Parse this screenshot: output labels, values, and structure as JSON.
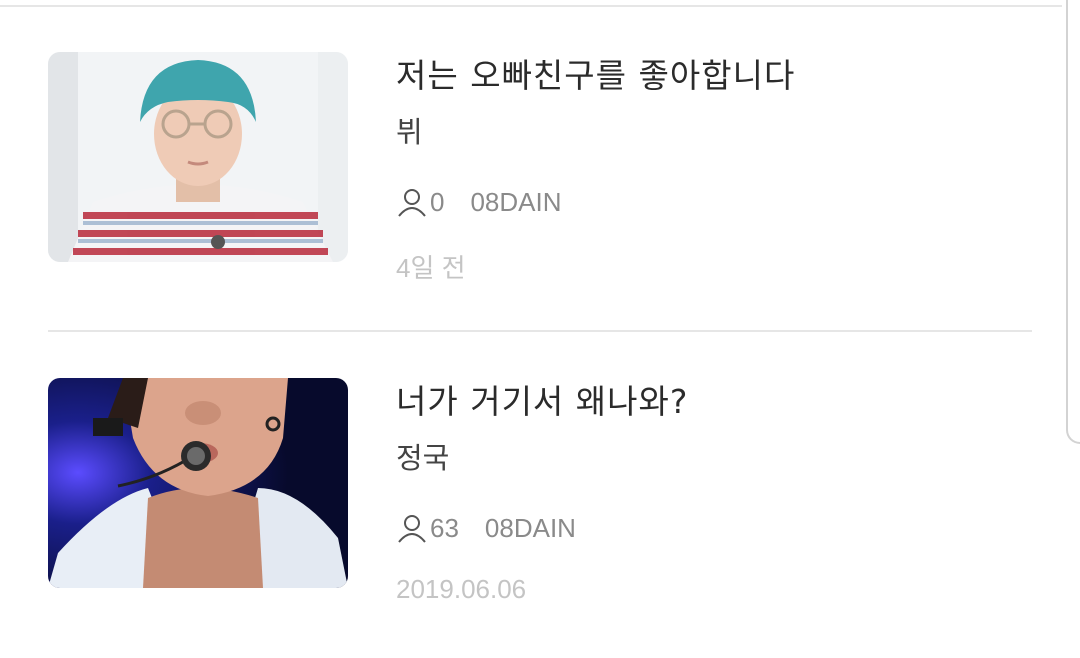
{
  "posts": [
    {
      "title": "저는 오빠친구를 좋아합니다",
      "category": "뷔",
      "views": "0",
      "author": "08DAIN",
      "date": "4일 전",
      "thumbnail_icon": "person-photo"
    },
    {
      "title": "너가 거기서 왜나와?",
      "category": "정국",
      "views": "63",
      "author": "08DAIN",
      "date": "2019.06.06",
      "thumbnail_icon": "person-photo"
    }
  ],
  "colors": {
    "title": "#2b2b2b",
    "meta": "#8a8a8a",
    "date": "#c4c4c4",
    "divider": "#e6e6e6"
  }
}
